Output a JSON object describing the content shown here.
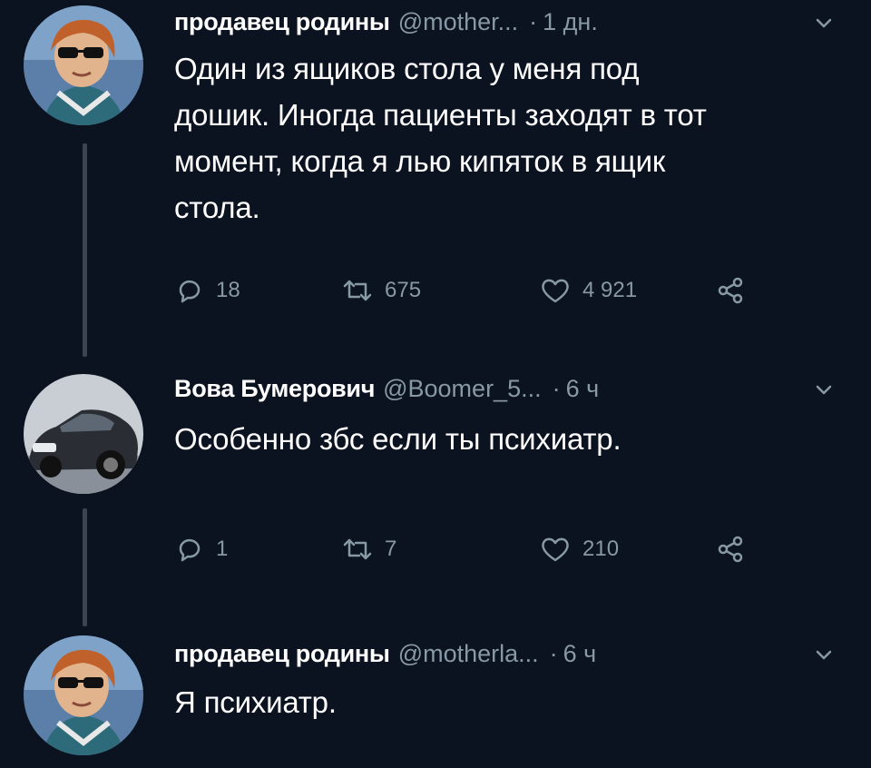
{
  "tweets": [
    {
      "name": "продавец родины",
      "handle": "@mother...",
      "separator": "·",
      "time": "1 дн.",
      "text_lines": [
        "Один из ящиков стола у меня под",
        "дошик. Иногда пациенты заходят в тот",
        "момент, когда я лью кипяток в ящик",
        "стола."
      ],
      "replies": "18",
      "retweets": "675",
      "likes": "4 921"
    },
    {
      "name": "Вова Бумерович",
      "handle": "@Boomer_5...",
      "separator": "·",
      "time": "6 ч",
      "text_lines": [
        "Особенно збс если ты психиатр."
      ],
      "replies": "1",
      "retweets": "7",
      "likes": "210"
    },
    {
      "name": "продавец родины",
      "handle": "@motherla...",
      "separator": "·",
      "time": "6 ч",
      "text_lines": [
        "Я психиатр."
      ]
    }
  ],
  "icons": {
    "reply": "reply-icon",
    "retweet": "retweet-icon",
    "like": "heart-icon",
    "share": "share-icon",
    "menu": "chevron-down-icon"
  },
  "colors": {
    "background": "#0b1220",
    "primary_text": "#ffffff",
    "secondary_text": "#8899a6",
    "thread_line": "#3a4452"
  }
}
